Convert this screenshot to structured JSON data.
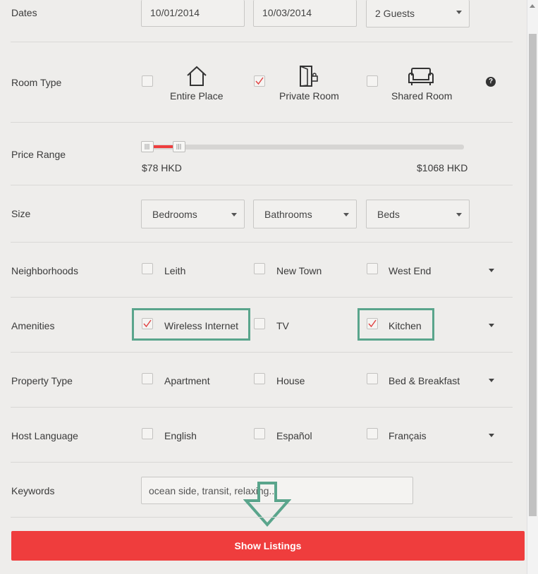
{
  "dates": {
    "label": "Dates",
    "checkin": "10/01/2014",
    "checkout": "10/03/2014",
    "guests": "2 Guests"
  },
  "room_type": {
    "label": "Room Type",
    "options": [
      {
        "label": "Entire Place",
        "checked": false,
        "icon": "house-icon"
      },
      {
        "label": "Private Room",
        "checked": true,
        "icon": "door-icon"
      },
      {
        "label": "Shared Room",
        "checked": false,
        "icon": "sofa-icon"
      }
    ],
    "help_icon": "?"
  },
  "price_range": {
    "label": "Price Range",
    "min_label": "$78 HKD",
    "max_label": "$1068 HKD",
    "accent_color": "#ef3d3d"
  },
  "size": {
    "label": "Size",
    "bedrooms": "Bedrooms",
    "bathrooms": "Bathrooms",
    "beds": "Beds"
  },
  "neighborhoods": {
    "label": "Neighborhoods",
    "options": [
      {
        "label": "Leith",
        "checked": false
      },
      {
        "label": "New Town",
        "checked": false
      },
      {
        "label": "West End",
        "checked": false
      }
    ]
  },
  "amenities": {
    "label": "Amenities",
    "options": [
      {
        "label": "Wireless Internet",
        "checked": true
      },
      {
        "label": "TV",
        "checked": false
      },
      {
        "label": "Kitchen",
        "checked": true
      }
    ]
  },
  "property_type": {
    "label": "Property Type",
    "options": [
      {
        "label": "Apartment",
        "checked": false
      },
      {
        "label": "House",
        "checked": false
      },
      {
        "label": "Bed & Breakfast",
        "checked": false
      }
    ]
  },
  "host_language": {
    "label": "Host Language",
    "options": [
      {
        "label": "English",
        "checked": false
      },
      {
        "label": "Español",
        "checked": false
      },
      {
        "label": "Français",
        "checked": false
      }
    ]
  },
  "keywords": {
    "label": "Keywords",
    "value": "ocean side, transit, relaxing..."
  },
  "show_listings": "Show Listings",
  "colors": {
    "brand": "#ef3d3d",
    "highlight": "#5aa58c"
  }
}
